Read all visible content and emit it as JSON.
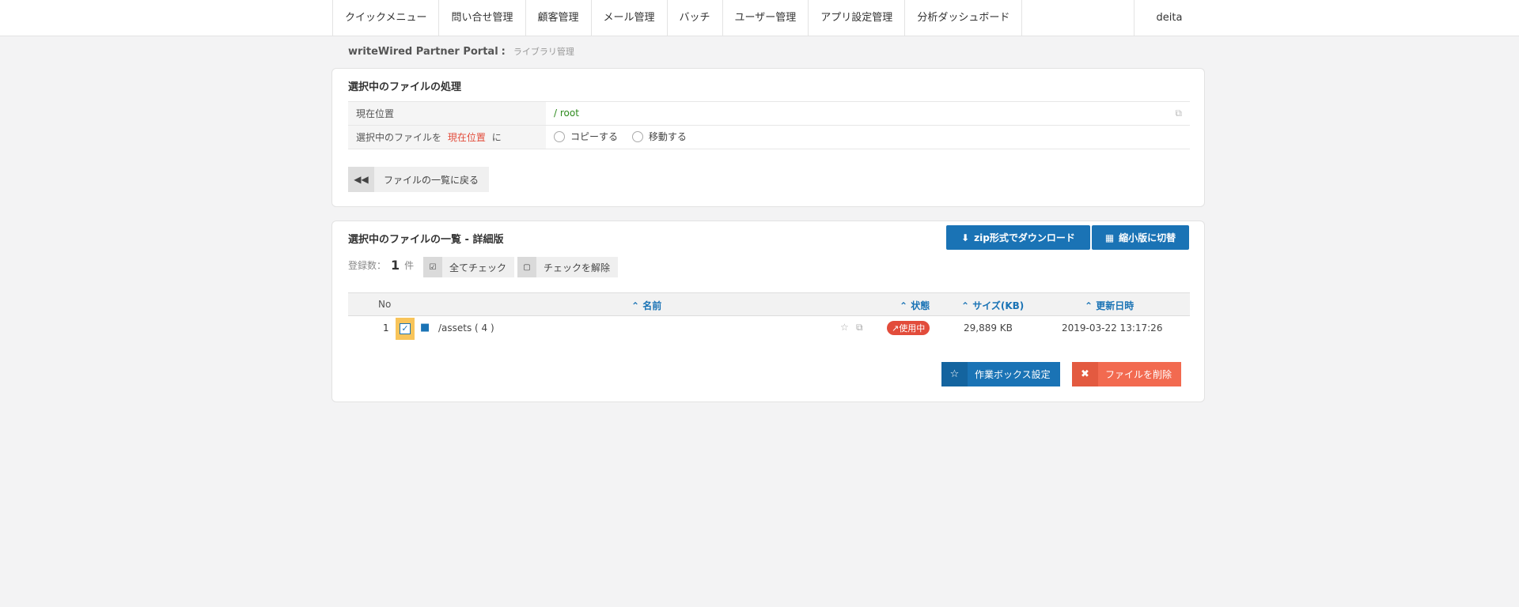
{
  "nav": {
    "items": [
      "クイックメニュー",
      "問い合せ管理",
      "顧客管理",
      "メール管理",
      "バッチ",
      "ユーザー管理",
      "アプリ設定管理",
      "分析ダッシュボード"
    ],
    "user": "deita"
  },
  "breadcrumb": {
    "title": "writeWired Partner Portal",
    "separator": ":",
    "current": "ライブラリ管理"
  },
  "process_panel": {
    "title": "選択中のファイルの処理",
    "location_label": "現在位置",
    "location_value": "/ root",
    "action_label_pre": "選択中のファイルを",
    "action_label_hl": "現在位置",
    "action_label_post": "に",
    "option_copy": "コピーする",
    "option_move": "移動する",
    "back_button": "ファイルの一覧に戻る"
  },
  "list_panel": {
    "title": "選択中のファイルの一覧 - 詳細版",
    "zip_button": "zip形式でダウンロード",
    "thumb_button": "縮小版に切替",
    "count_label": "登録数：",
    "count_value": "1",
    "count_unit": "件",
    "check_all": "全てチェック",
    "uncheck": "チェックを解除",
    "columns": {
      "no": "No",
      "name": "名前",
      "status": "状態",
      "size": "サイズ(KB)",
      "updated": "更新日時"
    },
    "rows": [
      {
        "no": "1",
        "name": "/assets ( 4 )",
        "status": "使用中",
        "size": "29,889 KB",
        "updated": "2019-03-22 13:17:26",
        "checked": true
      }
    ],
    "workbox_button": "作業ボックス設定",
    "delete_button": "ファイルを削除"
  },
  "colors": {
    "primary": "#1a73b5",
    "danger": "#e24c3b",
    "delete": "#f26a50",
    "highlight": "#f8c45a"
  }
}
